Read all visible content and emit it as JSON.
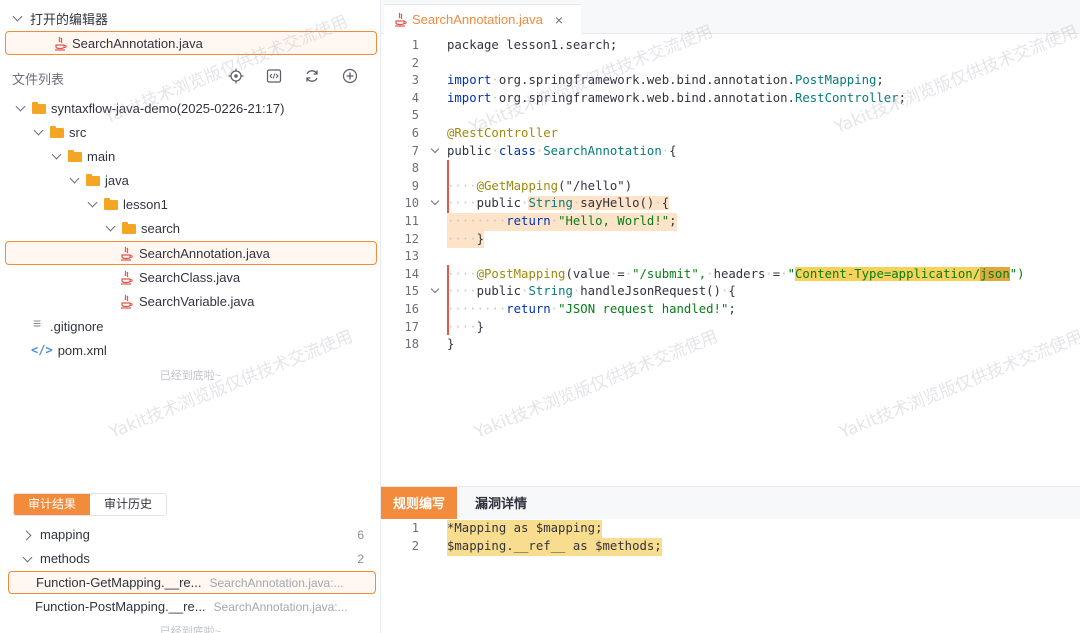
{
  "open_editors": {
    "header": "打开的编辑器",
    "file": "SearchAnnotation.java"
  },
  "files": {
    "header": "文件列表",
    "tools": [
      "locate-icon",
      "code-icon",
      "refresh-icon",
      "add-icon"
    ],
    "tree": [
      {
        "label": "syntaxflow-java-demo(2025-0226-21:17)",
        "type": "folder"
      },
      {
        "label": "src",
        "type": "folder"
      },
      {
        "label": "main",
        "type": "folder"
      },
      {
        "label": "java",
        "type": "folder"
      },
      {
        "label": "lesson1",
        "type": "folder"
      },
      {
        "label": "search",
        "type": "folder"
      },
      {
        "label": "SearchAnnotation.java",
        "type": "java"
      },
      {
        "label": "SearchClass.java",
        "type": "java"
      },
      {
        "label": "SearchVariable.java",
        "type": "java"
      },
      {
        "label": ".gitignore",
        "type": "file"
      },
      {
        "label": "pom.xml",
        "type": "xml"
      }
    ],
    "end_note": "已经到底啦~"
  },
  "audit": {
    "tabs": [
      "审计结果",
      "审计历史"
    ],
    "groups": [
      {
        "name": "mapping",
        "count": "6"
      },
      {
        "name": "methods",
        "count": "2"
      }
    ],
    "items": [
      {
        "fn": "Function-GetMapping.__re...",
        "loc": "SearchAnnotation.java:..."
      },
      {
        "fn": "Function-PostMapping.__re...",
        "loc": "SearchAnnotation.java:..."
      }
    ],
    "end_note": "已经到底啦~"
  },
  "editor": {
    "tab_label": "SearchAnnotation.java",
    "close": "×",
    "line_numbers": [
      "1",
      "2",
      "3",
      "4",
      "5",
      "6",
      "7",
      "8",
      "9",
      "10",
      "11",
      "12",
      "13",
      "14",
      "15",
      "16",
      "17",
      "18"
    ],
    "code": {
      "l1": "package lesson1.search;",
      "l3_kw": "import",
      "l3_rest": "org.springframework.web.bind.annotation.",
      "l3_cls": "PostMapping",
      "l4_kw": "import",
      "l4_rest": "org.springframework.web.bind.annotation.",
      "l4_cls": "RestController",
      "l6": "@RestController",
      "l7_a": "public",
      "l7_b": "class",
      "l7_c": "SearchAnnotation",
      "l7_d": "{",
      "l9_ann": "@GetMapping",
      "l9_str": "(\"/hello\")",
      "l10_a": "public",
      "l10_b": "String",
      "l10_c": "sayHello()",
      "l10_d": "{",
      "l11_kw": "return",
      "l11_str": "\"Hello, World!\"",
      "l11_end": ";",
      "l12": "}",
      "l14_ann": "@PostMapping",
      "l14_a": "(value",
      "l14_b": "=",
      "l14_c": "\"/submit\",",
      "l14_d": "headers",
      "l14_e": "=",
      "l14_q": "\"",
      "l14_f": "Content-Type=application/",
      "l14_g": "json",
      "l14_h": "\")",
      "l15_a": "public",
      "l15_b": "String",
      "l15_c": "handleJsonRequest()",
      "l15_d": "{",
      "l16_kw": "return",
      "l16_str": "\"JSON request handled!\"",
      "l16_end": ";",
      "l17": "}",
      "l18": "}"
    }
  },
  "bottom": {
    "tabs": [
      "规则编写",
      "漏洞详情"
    ],
    "line_numbers": [
      "1",
      "2"
    ],
    "rule_l1": "*Mapping as $mapping;",
    "rule_l2": "$mapping.__ref__ as $methods;"
  },
  "watermark": "Yakit技术浏览版仅供技术交流使用",
  "colors": {
    "accent": "#f28b3c",
    "highlight": "#fde3c8",
    "match": "#f7d25a"
  }
}
